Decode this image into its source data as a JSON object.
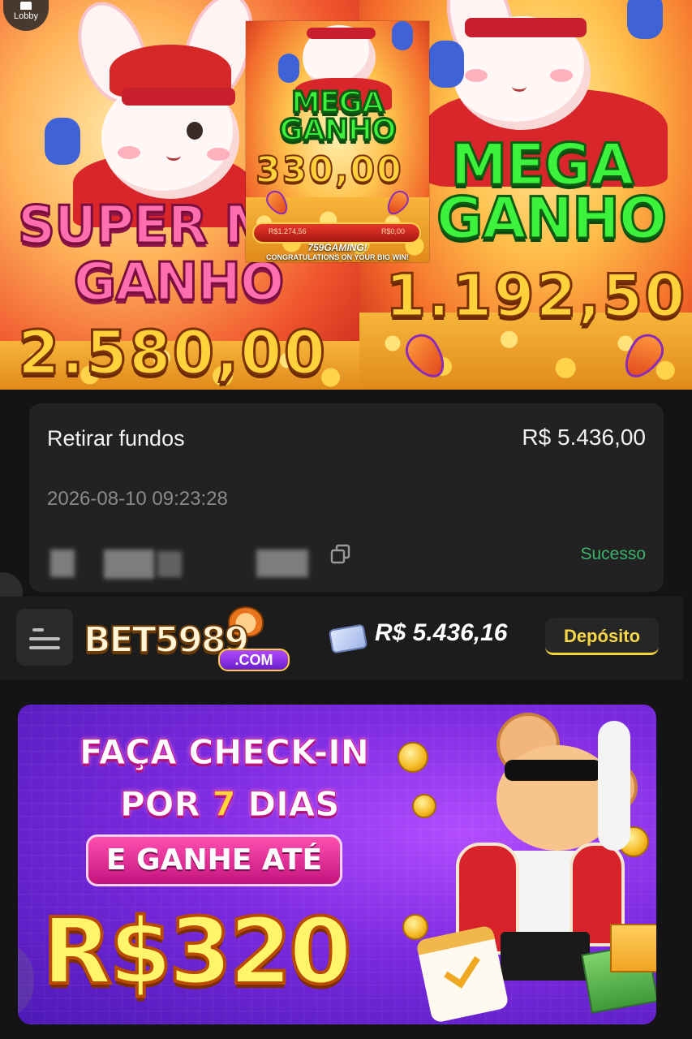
{
  "lobby_label": "Lobby",
  "collage": {
    "left": {
      "title_line1": "SUPER ME",
      "title_line2": "GANHO",
      "amount": "2.580,00"
    },
    "center": {
      "title_line1": "MEGA",
      "title_line2": "GANHO",
      "amount": "330,00",
      "rail_left": "R$1.274,56",
      "rail_right": "R$0,00",
      "caption_brand": "759GAMING!",
      "caption_congrats": "CONGRATULATIONS ON YOUR BIG WIN!"
    },
    "right": {
      "title_line1": "MEGA",
      "title_line2": "GANHO",
      "amount": "1.192,50"
    }
  },
  "transaction": {
    "title": "Retirar fundos",
    "amount": "R$ 5.436,00",
    "date": "2026-08-10 09:23:28",
    "status": "Sucesso",
    "status_color": "#3bb36b"
  },
  "header": {
    "logo_text": "BET5989",
    "logo_domain": ".COM",
    "balance": "R$ 5.436,16",
    "deposit_label": "Depósito",
    "accent_color": "#f4d23a"
  },
  "promo": {
    "line1": "FAÇA CHECK-IN",
    "line2_prefix": "POR",
    "line2_number": "7",
    "line2_suffix": "DIAS",
    "pill": "E GANHE ATÉ",
    "amount": "R$320"
  }
}
